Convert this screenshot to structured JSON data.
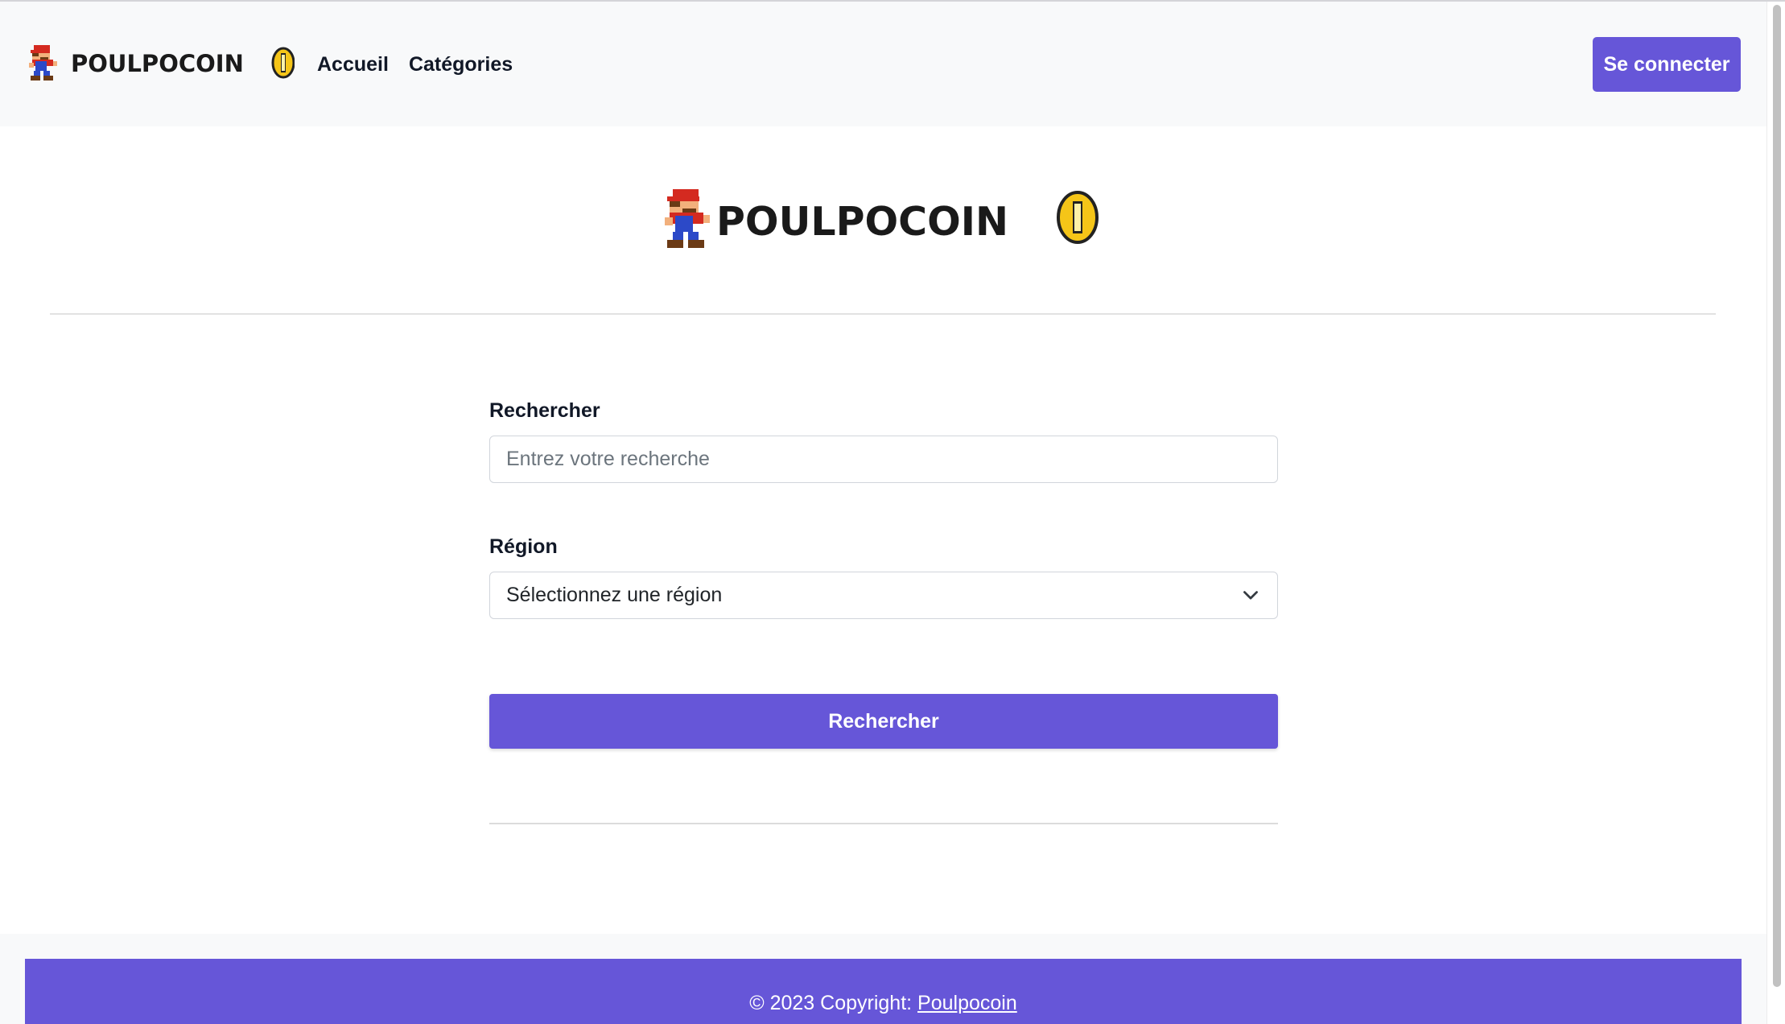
{
  "brand": {
    "name": "POULPOCOIN",
    "colors": {
      "accent": "#6656d8",
      "navbar_bg": "#f8f9fa",
      "coin": "#f5c518",
      "logo_text": "#1a1a1a"
    }
  },
  "nav": {
    "links": [
      {
        "label": "Accueil"
      },
      {
        "label": "Catégories"
      }
    ],
    "login_label": "Se connecter"
  },
  "search": {
    "label": "Rechercher",
    "placeholder": "Entrez votre recherche",
    "value": ""
  },
  "region": {
    "label": "Région",
    "selected": "Sélectionnez une région",
    "icon": "chevron-down-icon"
  },
  "submit_label": "Rechercher",
  "footer": {
    "copyright": "© 2023 Copyright: ",
    "link": "Poulpocoin"
  }
}
